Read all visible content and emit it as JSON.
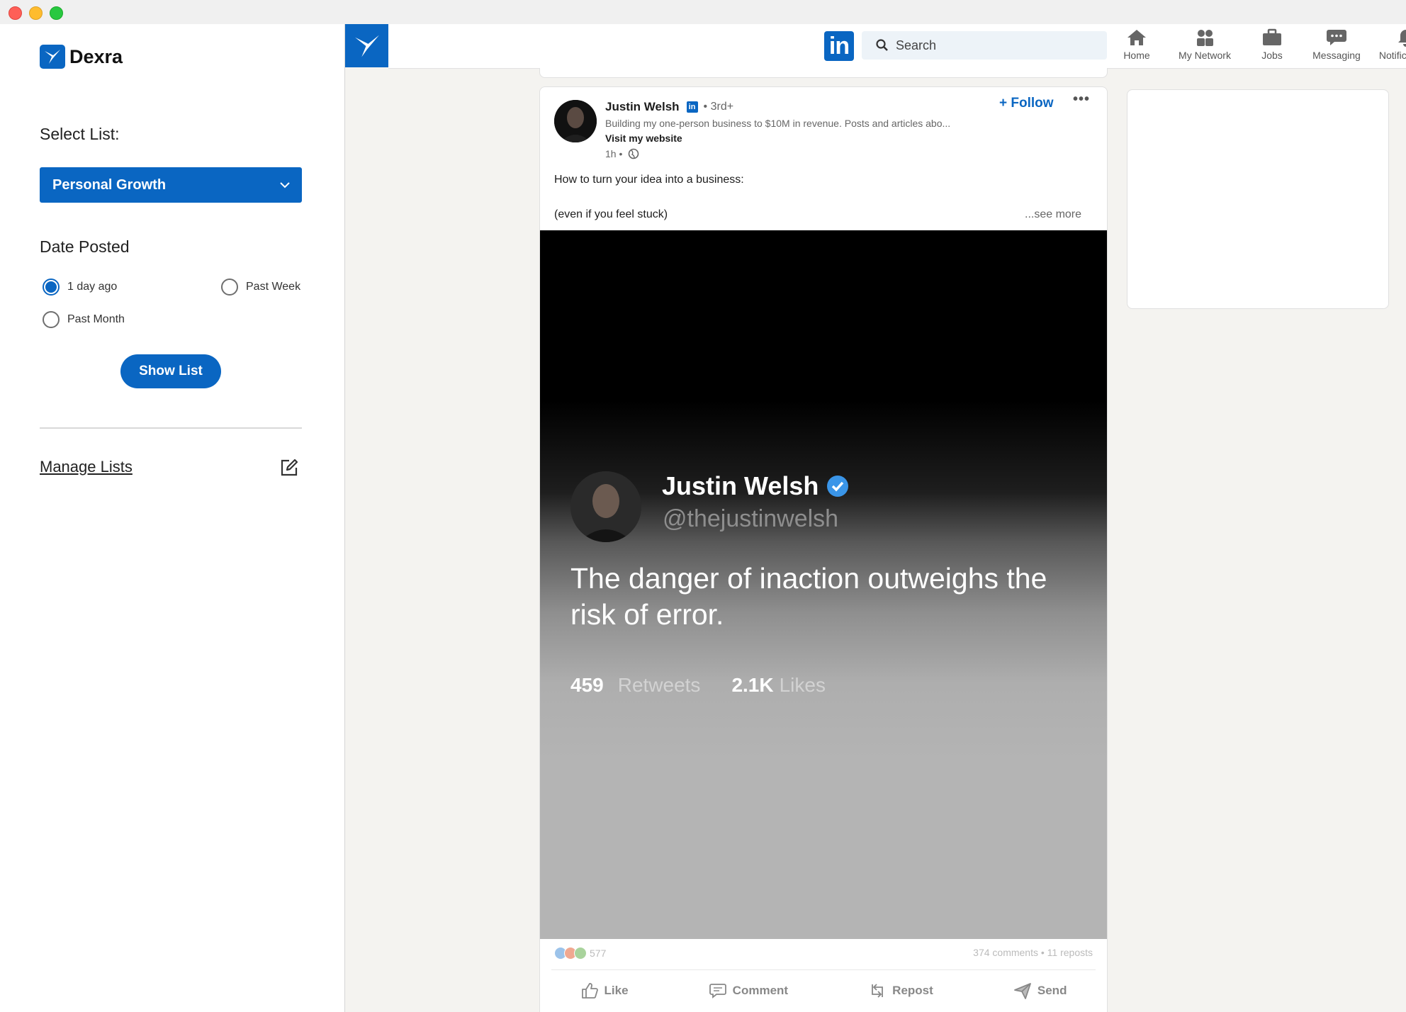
{
  "sidebar": {
    "app_name": "Dexra",
    "select_list_label": "Select List:",
    "selected_list": "Personal Growth",
    "date_posted_label": "Date Posted",
    "date_options": [
      {
        "label": "1 day ago",
        "selected": true
      },
      {
        "label": "Past Week",
        "selected": false
      },
      {
        "label": "Past Month",
        "selected": false
      }
    ],
    "show_list_button": "Show List",
    "manage_lists_link": "Manage Lists"
  },
  "linkedin": {
    "logo_text": "in",
    "search_placeholder": "Search",
    "nav": [
      {
        "label": "Home",
        "icon": "home-icon"
      },
      {
        "label": "My Network",
        "icon": "network-icon"
      },
      {
        "label": "Jobs",
        "icon": "briefcase-icon"
      },
      {
        "label": "Messaging",
        "icon": "messaging-icon"
      },
      {
        "label": "Notifications",
        "icon": "bell-icon"
      }
    ],
    "post": {
      "author": "Justin Welsh",
      "degree": "• 3rd+",
      "headline": "Building my one-person business to $10M in revenue. Posts and articles abo...",
      "website_link": "Visit my website",
      "time": "1h •",
      "follow_label": "+ Follow",
      "more_label": "•••",
      "text_line1": "How to turn your idea into a business:",
      "text_line2": "(even if you feel stuck)",
      "see_more": "...see more",
      "tweet": {
        "name": "Justin Welsh",
        "handle": "@thejustinwelsh",
        "quote": "The danger of inaction outweighs the risk of error.",
        "retweets_count": "459",
        "retweets_label": "Retweets",
        "likes_count": "2.1K",
        "likes_label": "Likes"
      },
      "reactions_count": "577",
      "comments_reposts": "374 comments • 11 reposts",
      "actions": [
        "Like",
        "Comment",
        "Repost",
        "Send"
      ]
    }
  },
  "colors": {
    "brand_blue": "#0a66c2",
    "sidebar_bg": "#ffffff",
    "feed_bg": "#f4f3f0"
  }
}
